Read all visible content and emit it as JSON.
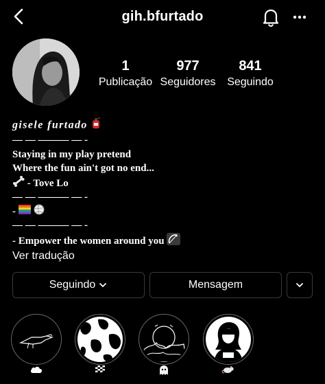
{
  "header": {
    "username": "gih.bfurtado"
  },
  "stats": [
    {
      "value": "1",
      "label": "Publicação"
    },
    {
      "value": "977",
      "label": "Seguidores"
    },
    {
      "value": "841",
      "label": "Seguindo"
    }
  ],
  "bio": {
    "name": "gisele furtado",
    "lines": [
      "— — ——— — -",
      "Staying in my play pretend",
      "Where the fun ain't got no end...",
      " - Tove Lo",
      "— — ——— — -",
      "- ",
      "— — ——— — -",
      "- Empower the women around you "
    ],
    "translate": "Ver tradução"
  },
  "actions": {
    "following": "Seguindo",
    "message": "Mensagem"
  },
  "icons": {
    "back": "chevron-left-icon",
    "bell": "bell-icon",
    "more": "ellipsis-icon",
    "fire_extinguisher": "fire-extinguisher-icon",
    "bone": "bone-icon",
    "rainbow_flag": "rainbow-flag-icon",
    "volleyball": "volleyball-icon",
    "bow_arrow": "bow-arrow-icon",
    "chevron_down": "chevron-down-icon",
    "cloud": "cloud-icon",
    "checkered_flag": "checkered-flag-icon",
    "ghost": "ghost-icon",
    "rat": "rat-icon"
  },
  "colors": {
    "background": "#000000",
    "text": "#ffffff",
    "button_border": "#3a3a3a"
  }
}
